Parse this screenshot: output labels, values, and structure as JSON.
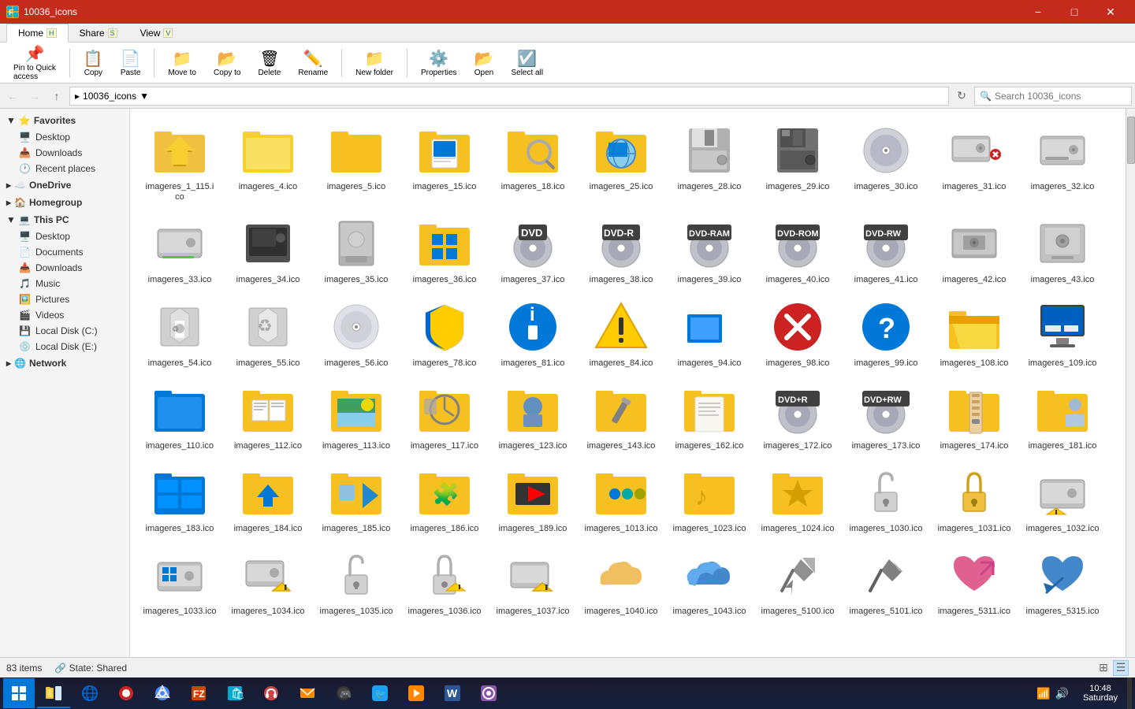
{
  "window": {
    "title": "10036_icons",
    "tabs": [
      "Home",
      "Share",
      "View"
    ],
    "tab_shortcuts": [
      "H",
      "S",
      "V"
    ]
  },
  "address": {
    "path": "10036_icons",
    "search_placeholder": "Search 10036_icons"
  },
  "sidebar": {
    "favorites_label": "Favorites",
    "favorites_items": [
      "Desktop",
      "Downloads",
      "Recent places"
    ],
    "onedrive_label": "OneDrive",
    "homegroup_label": "Homegroup",
    "thispc_label": "This PC",
    "thispc_items": [
      "Desktop",
      "Documents",
      "Downloads",
      "Music",
      "Pictures",
      "Videos",
      "Local Disk (C:)",
      "Local Disk (E:)"
    ],
    "network_label": "Network"
  },
  "icons": [
    {
      "name": "imageres_1_115.ico",
      "type": "star_folder"
    },
    {
      "name": "imageres_4.ico",
      "type": "folder_plain"
    },
    {
      "name": "imageres_5.ico",
      "type": "folder_plain2"
    },
    {
      "name": "imageres_15.ico",
      "type": "folder_doc"
    },
    {
      "name": "imageres_18.ico",
      "type": "folder_search"
    },
    {
      "name": "imageres_25.ico",
      "type": "globe_folder"
    },
    {
      "name": "imageres_28.ico",
      "type": "floppy_35"
    },
    {
      "name": "imageres_29.ico",
      "type": "floppy_35_dark"
    },
    {
      "name": "imageres_30.ico",
      "type": "cd"
    },
    {
      "name": "imageres_31.ico",
      "type": "hdd_x"
    },
    {
      "name": "imageres_32.ico",
      "type": "hdd_gray"
    },
    {
      "name": "imageres_33.ico",
      "type": "hdd_green"
    },
    {
      "name": "imageres_34.ico",
      "type": "ram"
    },
    {
      "name": "imageres_35.ico",
      "type": "drive_removable"
    },
    {
      "name": "imageres_36.ico",
      "type": "windows_logo"
    },
    {
      "name": "imageres_37.ico",
      "type": "dvd"
    },
    {
      "name": "imageres_38.ico",
      "type": "dvd_r"
    },
    {
      "name": "imageres_39.ico",
      "type": "dvd_ram"
    },
    {
      "name": "imageres_40.ico",
      "type": "dvd_rom"
    },
    {
      "name": "imageres_41.ico",
      "type": "dvd_rw"
    },
    {
      "name": "imageres_42.ico",
      "type": "zip_drive"
    },
    {
      "name": "imageres_43.ico",
      "type": "tape_drive"
    },
    {
      "name": "imageres_54.ico",
      "type": "recycle_full"
    },
    {
      "name": "imageres_55.ico",
      "type": "recycle_empty"
    },
    {
      "name": "imageres_56.ico",
      "type": "cd_blank"
    },
    {
      "name": "imageres_78.ico",
      "type": "uac_shield"
    },
    {
      "name": "imageres_81.ico",
      "type": "info_blue"
    },
    {
      "name": "imageres_84.ico",
      "type": "warning_yellow"
    },
    {
      "name": "imageres_94.ico",
      "type": "maximize_blue"
    },
    {
      "name": "imageres_98.ico",
      "type": "error_red"
    },
    {
      "name": "imageres_99.ico",
      "type": "question_blue"
    },
    {
      "name": "imageres_108.ico",
      "type": "folder_open"
    },
    {
      "name": "imageres_109.ico",
      "type": "monitor"
    },
    {
      "name": "imageres_110.ico",
      "type": "folder_blue"
    },
    {
      "name": "imageres_112.ico",
      "type": "folder_docs"
    },
    {
      "name": "imageres_113.ico",
      "type": "folder_photos"
    },
    {
      "name": "imageres_117.ico",
      "type": "folder_clock"
    },
    {
      "name": "imageres_123.ico",
      "type": "folder_user"
    },
    {
      "name": "imageres_143.ico",
      "type": "folder_pencil"
    },
    {
      "name": "imageres_162.ico",
      "type": "folder_document"
    },
    {
      "name": "imageres_172.ico",
      "type": "dvd_plus_r"
    },
    {
      "name": "imageres_173.ico",
      "type": "dvd_plus_rw"
    },
    {
      "name": "imageres_174.ico",
      "type": "folder_zip"
    },
    {
      "name": "imageres_181.ico",
      "type": "folder_user2"
    },
    {
      "name": "imageres_183.ico",
      "type": "folder_winblue"
    },
    {
      "name": "imageres_184.ico",
      "type": "folder_download"
    },
    {
      "name": "imageres_185.ico",
      "type": "folder_arrow"
    },
    {
      "name": "imageres_186.ico",
      "type": "folder_puzzle"
    },
    {
      "name": "imageres_189.ico",
      "type": "folder_video"
    },
    {
      "name": "imageres_1013.ico",
      "type": "folder_dots"
    },
    {
      "name": "imageres_1023.ico",
      "type": "folder_music"
    },
    {
      "name": "imageres_1024.ico",
      "type": "folder_star"
    },
    {
      "name": "imageres_1030.ico",
      "type": "lock_open"
    },
    {
      "name": "imageres_1031.ico",
      "type": "lock_closed"
    },
    {
      "name": "imageres_1032.ico",
      "type": "hdd_warning"
    },
    {
      "name": "imageres_1033.ico",
      "type": "hdd_windows"
    },
    {
      "name": "imageres_1034.ico",
      "type": "hdd_warning2"
    },
    {
      "name": "imageres_1035.ico",
      "type": "lock_open2"
    },
    {
      "name": "imageres_1036.ico",
      "type": "lock_warning"
    },
    {
      "name": "imageres_1037.ico",
      "type": "hdd_warning3"
    },
    {
      "name": "imageres_1040.ico",
      "type": "onedrive"
    },
    {
      "name": "imageres_1043.ico",
      "type": "onedrive_blue"
    },
    {
      "name": "imageres_5100.ico",
      "type": "pushpin"
    },
    {
      "name": "imageres_5101.ico",
      "type": "pushpin2"
    },
    {
      "name": "imageres_5311.ico",
      "type": "heart_arrow"
    },
    {
      "name": "imageres_5315.ico",
      "type": "heart_back"
    }
  ],
  "status": {
    "count": "83 items",
    "state_label": "State:",
    "state_value": "Shared"
  },
  "taskbar": {
    "time": "10:48",
    "day": "Saturday"
  }
}
